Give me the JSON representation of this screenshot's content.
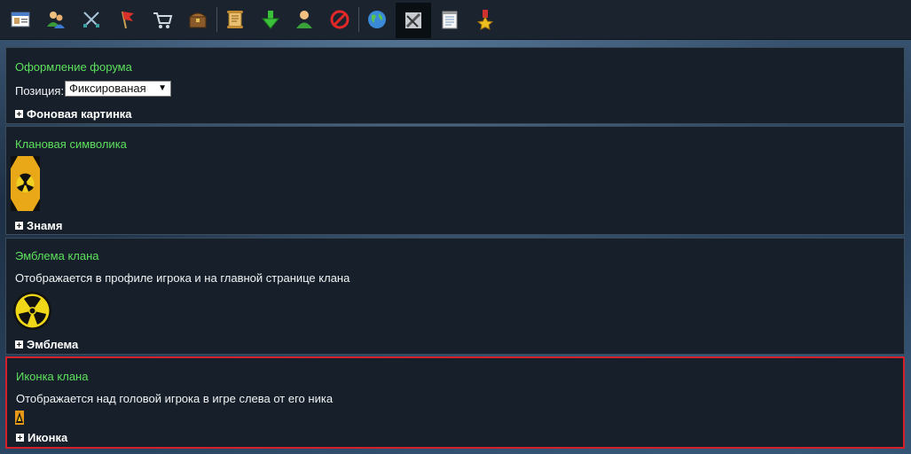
{
  "toolbar": {
    "icons": [
      "clan-card-icon",
      "members-icon",
      "swords-icon",
      "flag-icon",
      "cart-icon",
      "chest-icon",
      "scroll-icon",
      "download-arrow-icon",
      "user-icon",
      "forbidden-icon",
      "globe-icon",
      "settings-tools-icon",
      "notepad-icon",
      "medal-icon"
    ],
    "active": "settings-tools-icon"
  },
  "forum_panel": {
    "title": "Оформление форума",
    "position_label": "Позиция:",
    "position_value": "Фиксированая",
    "toggle_label": "Фоновая картинка"
  },
  "symbol_panel": {
    "title": "Клановая символика",
    "toggle_label": "Знамя"
  },
  "emblem_panel": {
    "title": "Эмблема клана",
    "description": "Отображается в профиле игрока и на главной странице клана",
    "toggle_label": "Эмблема"
  },
  "icon_panel": {
    "title": "Иконка клана",
    "description": "Отображается над головой игрока в игре слева от его ника",
    "toggle_label": "Иконка"
  },
  "colors": {
    "accent_green": "#5de05d",
    "highlight_red": "#d3202a",
    "panel_bg": "#17202a"
  }
}
